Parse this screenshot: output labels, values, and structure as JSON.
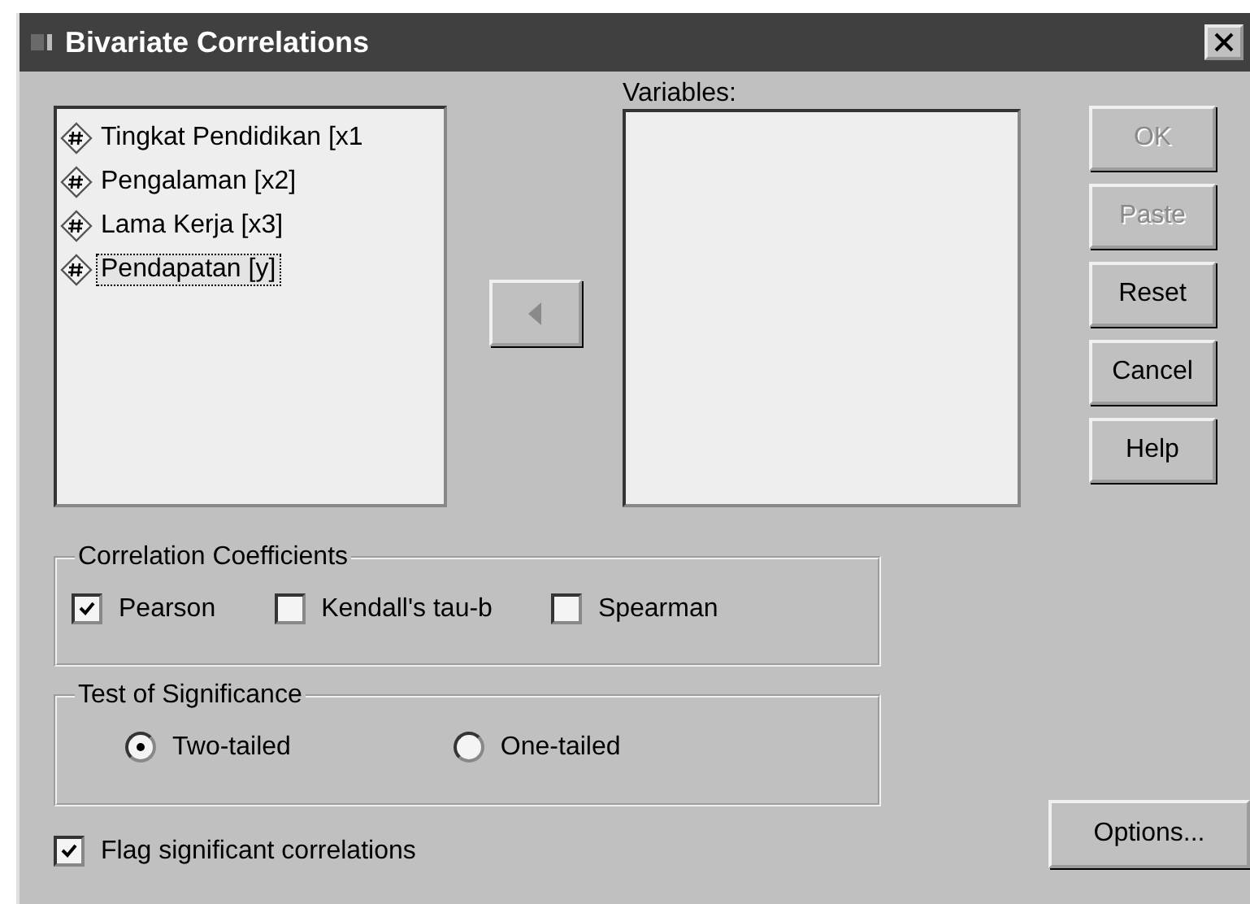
{
  "window": {
    "title": "Bivariate Correlations"
  },
  "source_list": {
    "items": [
      {
        "label": "Tingkat Pendidikan [x1",
        "selected": false
      },
      {
        "label": "Pengalaman [x2]",
        "selected": false
      },
      {
        "label": "Lama Kerja [x3]",
        "selected": false
      },
      {
        "label": "Pendapatan [y]",
        "selected": true
      }
    ]
  },
  "move_button": {
    "disabled": true
  },
  "variables": {
    "label": "Variables:"
  },
  "buttons": [
    {
      "label": "OK",
      "disabled": true
    },
    {
      "label": "Paste",
      "disabled": true
    },
    {
      "label": "Reset",
      "disabled": false
    },
    {
      "label": "Cancel",
      "disabled": false
    },
    {
      "label": "Help",
      "disabled": false
    }
  ],
  "correlation_coefficients": {
    "title": "Correlation Coefficients",
    "options": [
      {
        "label": "Pearson",
        "checked": true
      },
      {
        "label": "Kendall's tau-b",
        "checked": false
      },
      {
        "label": "Spearman",
        "checked": false
      }
    ]
  },
  "test_of_significance": {
    "title": "Test of Significance",
    "options": [
      {
        "label": "Two-tailed",
        "selected": true
      },
      {
        "label": "One-tailed",
        "selected": false
      }
    ]
  },
  "flag": {
    "label": "Flag significant correlations",
    "checked": true
  },
  "options_button": {
    "label": "Options..."
  }
}
